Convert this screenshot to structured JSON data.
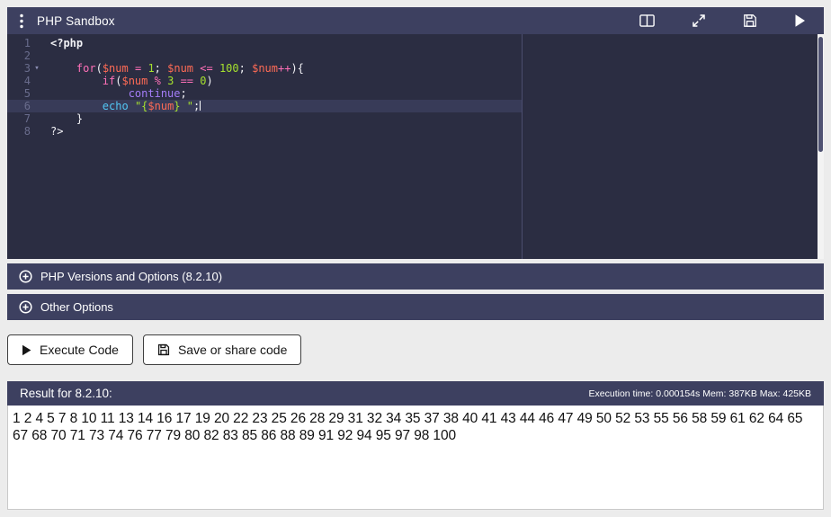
{
  "colors": {
    "navy": "#3d4060",
    "editor_bg": "#2b2d42",
    "active_line": "#383b58",
    "gutter": "#696c8c",
    "plain": "#f2f2f6",
    "keyword": "#ff70b8",
    "variable": "#ff6b55",
    "number": "#a6e22e",
    "string": "#a6e22e",
    "keyword2": "#a47df8",
    "keyword3": "#52c7f5",
    "divider": "#4a4d6e",
    "page_bg": "#ececec"
  },
  "toolbar": {
    "title": "PHP Sandbox",
    "icons": [
      "menu-icon",
      "split-view-icon",
      "fullscreen-icon",
      "save-icon",
      "run-icon"
    ]
  },
  "editor": {
    "lines": [
      {
        "n": "1",
        "tokens": [
          [
            "meta",
            "<?php"
          ]
        ]
      },
      {
        "n": "2",
        "tokens": []
      },
      {
        "n": "3",
        "fold": true,
        "tokens": [
          [
            "pl",
            "    "
          ],
          [
            "kw",
            "for"
          ],
          [
            "pl",
            "("
          ],
          [
            "vr",
            "$num"
          ],
          [
            "pl",
            " "
          ],
          [
            "op",
            "="
          ],
          [
            "pl",
            " "
          ],
          [
            "nm",
            "1"
          ],
          [
            "pl",
            "; "
          ],
          [
            "vr",
            "$num"
          ],
          [
            "pl",
            " "
          ],
          [
            "op",
            "<="
          ],
          [
            "pl",
            " "
          ],
          [
            "nm",
            "100"
          ],
          [
            "pl",
            "; "
          ],
          [
            "vr",
            "$num"
          ],
          [
            "op",
            "++"
          ],
          [
            "pl",
            "){"
          ]
        ]
      },
      {
        "n": "4",
        "tokens": [
          [
            "pl",
            "        "
          ],
          [
            "kw",
            "if"
          ],
          [
            "pl",
            "("
          ],
          [
            "vr",
            "$num"
          ],
          [
            "pl",
            " "
          ],
          [
            "op",
            "%"
          ],
          [
            "pl",
            " "
          ],
          [
            "nm",
            "3"
          ],
          [
            "pl",
            " "
          ],
          [
            "op",
            "=="
          ],
          [
            "pl",
            " "
          ],
          [
            "nm",
            "0"
          ],
          [
            "pl",
            ")"
          ]
        ]
      },
      {
        "n": "5",
        "tokens": [
          [
            "pl",
            "            "
          ],
          [
            "kw2",
            "continue"
          ],
          [
            "pl",
            ";"
          ]
        ]
      },
      {
        "n": "6",
        "active": true,
        "cursor": true,
        "tokens": [
          [
            "pl",
            "        "
          ],
          [
            "kw3",
            "echo"
          ],
          [
            "pl",
            " "
          ],
          [
            "st",
            "\"{"
          ],
          [
            "vr",
            "$num"
          ],
          [
            "st",
            "} \""
          ],
          [
            "pl",
            ";"
          ]
        ]
      },
      {
        "n": "7",
        "tokens": [
          [
            "pl",
            "    }"
          ]
        ]
      },
      {
        "n": "8",
        "tokens": [
          [
            "pl",
            "?>"
          ]
        ]
      }
    ]
  },
  "accordions": [
    {
      "icon": "plus-circle-icon",
      "label": "PHP Versions and Options (8.2.10)"
    },
    {
      "icon": "plus-circle-icon",
      "label": "Other Options"
    }
  ],
  "actions": {
    "execute_label": "Execute Code",
    "execute_icon": "play-icon",
    "save_label": "Save or share code",
    "save_icon": "save-icon"
  },
  "result": {
    "title": "Result for 8.2.10:",
    "stats": "Execution time: 0.000154s Mem: 387KB Max: 425KB",
    "output": "1 2 4 5 7 8 10 11 13 14 16 17 19 20 22 23 25 26 28 29 31 32 34 35 37 38 40 41 43 44 46 47 49 50 52 53 55 56 58 59 61 62 64 65 67 68 70 71 73 74 76 77 79 80 82 83 85 86 88 89 91 92 94 95 97 98 100"
  }
}
